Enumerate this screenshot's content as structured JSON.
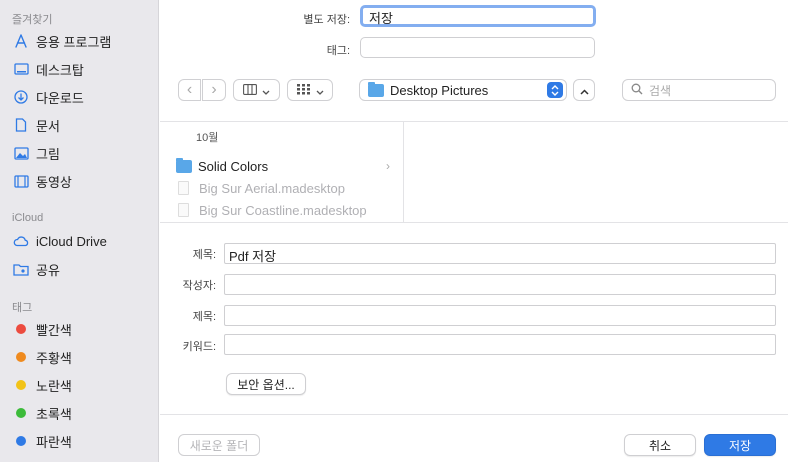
{
  "sidebar": {
    "favorites_header": "즐겨찾기",
    "favorites": [
      {
        "label": "응용 프로그램",
        "icon": "applications-icon"
      },
      {
        "label": "데스크탑",
        "icon": "desktop-icon"
      },
      {
        "label": "다운로드",
        "icon": "downloads-icon"
      },
      {
        "label": "문서",
        "icon": "document-icon"
      },
      {
        "label": "그림",
        "icon": "pictures-icon"
      },
      {
        "label": "동영상",
        "icon": "movies-icon"
      }
    ],
    "icloud_header": "iCloud",
    "icloud": [
      {
        "label": "iCloud Drive",
        "icon": "cloud-icon"
      },
      {
        "label": "공유",
        "icon": "shared-folder-icon"
      }
    ],
    "tags_header": "태그",
    "tags": [
      {
        "label": "빨간색",
        "color": "#ec4b3f"
      },
      {
        "label": "주황색",
        "color": "#ef8a1e"
      },
      {
        "label": "노란색",
        "color": "#f2c318"
      },
      {
        "label": "초록색",
        "color": "#3cbb3a"
      },
      {
        "label": "파란색",
        "color": "#2f7ae5"
      }
    ]
  },
  "save": {
    "save_as_label": "별도 저장:",
    "save_as_value": "저장",
    "tags_label": "태그:"
  },
  "toolbar": {
    "back": "‹",
    "forward": "›",
    "location": "Desktop Pictures",
    "search_placeholder": "검색"
  },
  "browser": {
    "group_header": "10월",
    "rows": [
      {
        "name": "Solid Colors",
        "type": "folder"
      },
      {
        "name": "Big Sur Aerial.madesktop",
        "type": "file"
      },
      {
        "name": "Big Sur Coastline.madesktop",
        "type": "file"
      }
    ]
  },
  "pdf": {
    "title_label": "제목:",
    "title_value": "Pdf 저장",
    "author_label": "작성자:",
    "subject_label": "제목:",
    "keywords_label": "키워드:",
    "security_button": "보안 옵션..."
  },
  "footer": {
    "new_folder": "새로운 폴더",
    "cancel": "취소",
    "save": "저장"
  },
  "colors": {
    "accent": "#2f7ae5",
    "sidebar_bg": "#e9e8ec"
  }
}
